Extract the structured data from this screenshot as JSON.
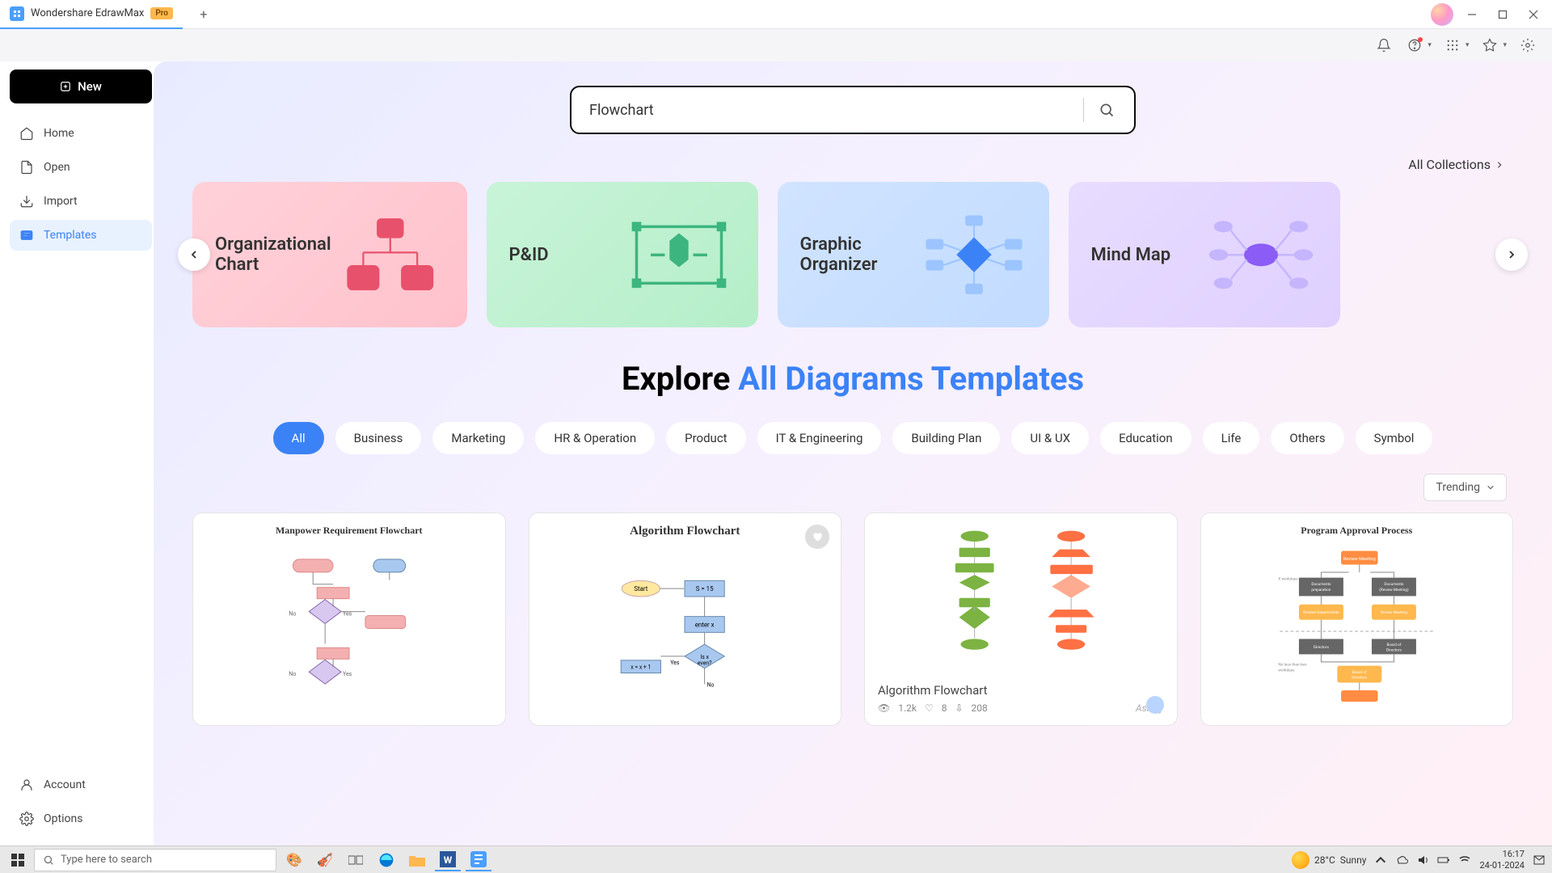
{
  "window": {
    "app_title": "Wondershare EdrawMax",
    "badge": "Pro"
  },
  "sidebar": {
    "new_label": "New",
    "items": [
      "Home",
      "Open",
      "Import",
      "Templates"
    ],
    "footer": [
      "Account",
      "Options"
    ]
  },
  "search": {
    "value": "Flowchart"
  },
  "collections_link": "All Collections",
  "categories": [
    {
      "label": "Organizational Chart"
    },
    {
      "label": "P&ID"
    },
    {
      "label": "Graphic Organizer"
    },
    {
      "label": "Mind Map"
    }
  ],
  "explore": {
    "prefix": "Explore ",
    "accent": "All Diagrams Templates"
  },
  "filters": [
    "All",
    "Business",
    "Marketing",
    "HR & Operation",
    "Product",
    "IT & Engineering",
    "Building Plan",
    "UI & UX",
    "Education",
    "Life",
    "Others",
    "Symbol"
  ],
  "sort_label": "Trending",
  "templates": [
    {
      "title": "Manpower Requirement Flowchart"
    },
    {
      "title": "Algorithm Flowchart"
    },
    {
      "title": "Algorithm Flowchart",
      "views": "1.2k",
      "likes": "8",
      "shares": "208",
      "author": "Ashley"
    },
    {
      "title": "Program Approval Process"
    }
  ],
  "taskbar": {
    "search_placeholder": "Type here to search",
    "weather_temp": "28°C",
    "weather_cond": "Sunny",
    "time": "16:17",
    "date": "24-01-2024"
  }
}
